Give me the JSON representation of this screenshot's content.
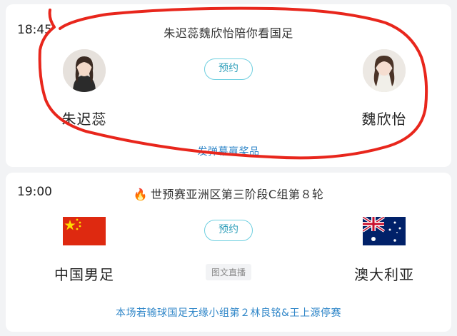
{
  "match1": {
    "time": "18:45",
    "title": "朱迟蕊魏欣怡陪你看国足",
    "left_name": "朱迟蕊",
    "right_name": "魏欣怡",
    "reserve_label": "预约",
    "footer": "发弹幕赢奖品"
  },
  "match2": {
    "time": "19:00",
    "title_icon": "fire-icon",
    "title": "世预赛亚洲区第三阶段C组第８轮",
    "left_team": "中国男足",
    "right_team": "澳大利亚",
    "reserve_label": "预约",
    "live_tag": "图文直播",
    "footer": "本场若输球国足无缘小组第２林良铭&王上源停赛"
  },
  "colors": {
    "accent": "#2f9fba",
    "link": "#2f86c8",
    "annotation": "#e8261c",
    "fire": "#ff5a1f"
  }
}
